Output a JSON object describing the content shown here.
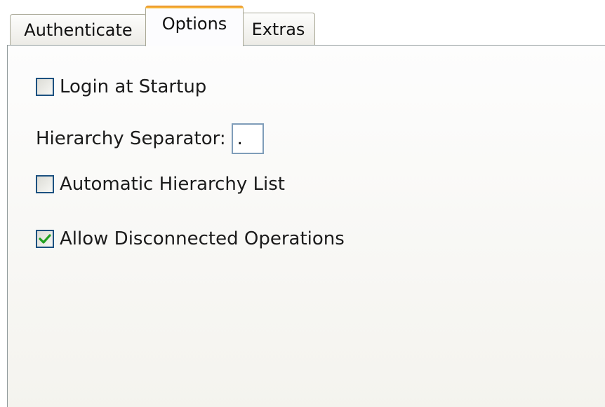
{
  "tabs": [
    {
      "label": "Authenticate",
      "selected": false
    },
    {
      "label": "Options",
      "selected": true
    },
    {
      "label": "Extras",
      "selected": false
    }
  ],
  "options": {
    "login_at_startup": {
      "label": "Login at Startup",
      "checked": false
    },
    "hierarchy_separator": {
      "label": "Hierarchy Separator:",
      "value": "."
    },
    "automatic_hierarchy_list": {
      "label": "Automatic Hierarchy List",
      "checked": false
    },
    "allow_disconnected_operations": {
      "label": "Allow Disconnected Operations",
      "checked": true
    }
  },
  "colors": {
    "active_tab_accent": "#f0a038",
    "checkbox_border": "#1c5180",
    "checkmark": "#21a121"
  }
}
